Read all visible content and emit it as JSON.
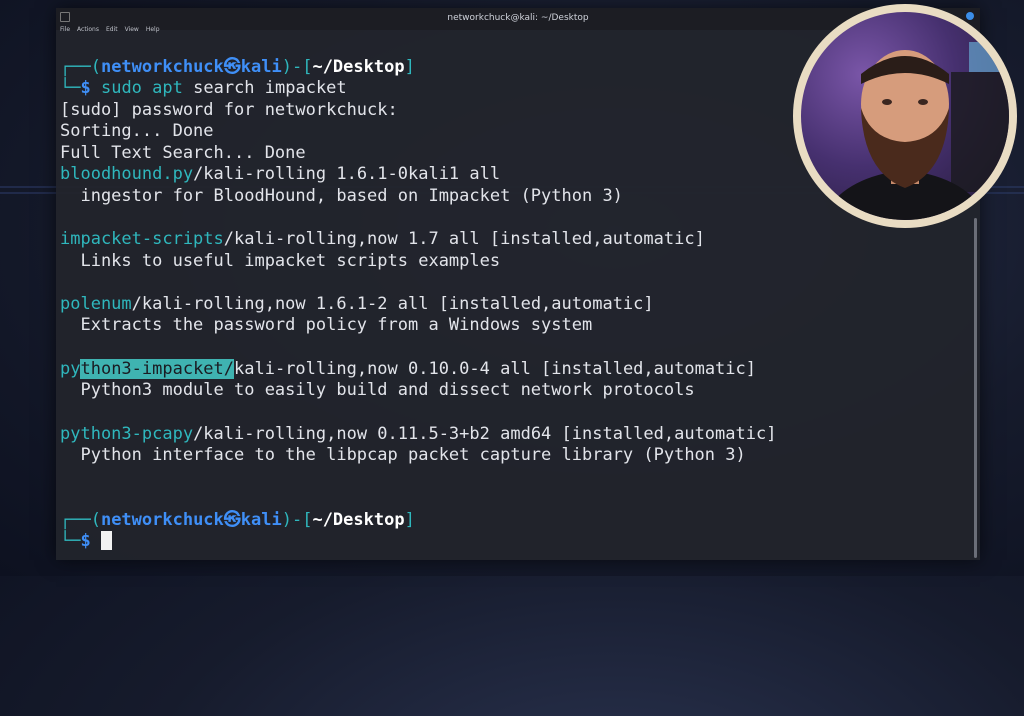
{
  "window": {
    "title": "networkchuck@kali: ~/Desktop",
    "menu": [
      "File",
      "Actions",
      "Edit",
      "View",
      "Help"
    ]
  },
  "prompt1": {
    "open": "┌──(",
    "user": "networkchuck",
    "at": "㉿",
    "host": "kali",
    "mid": ")-[",
    "path": "~/Desktop",
    "close": "]"
  },
  "command": {
    "corner": "└─",
    "dollar": "$ ",
    "sudo": "sudo",
    "apt": "apt",
    "rest": " search impacket"
  },
  "output": [
    "[sudo] password for networkchuck:",
    "Sorting... Done",
    "Full Text Search... Done"
  ],
  "packages": [
    {
      "name": "bloodhound.py",
      "info": "/kali-rolling 1.6.1-0kali1 all",
      "desc": "  ingestor for BloodHound, based on Impacket (Python 3)"
    },
    {
      "name": "impacket-scripts",
      "info": "/kali-rolling,now 1.7 all [installed,automatic]",
      "desc": "  Links to useful impacket scripts examples"
    },
    {
      "name": "polenum",
      "info": "/kali-rolling,now 1.6.1-2 all [installed,automatic]",
      "desc": "  Extracts the password policy from a Windows system"
    },
    {
      "name_pre": "py",
      "name_hl": "thon3-impacket/",
      "info": "kali-rolling,now 0.10.0-4 all [installed,automatic]",
      "desc": "  Python3 module to easily build and dissect network protocols"
    },
    {
      "name": "python3-pcapy",
      "info": "/kali-rolling,now 0.11.5-3+b2 amd64 [installed,automatic]",
      "desc": "  Python interface to the libpcap packet capture library (Python 3)"
    }
  ],
  "prompt2": {
    "open": "┌──(",
    "user": "networkchuck",
    "at": "㉿",
    "host": "kali",
    "mid": ")-[",
    "path": "~/Desktop",
    "close": "]",
    "corner": "└─",
    "dollar": "$ "
  },
  "colors": {
    "prompt_blue": "#3f8ff7",
    "teal": "#2fb7bd",
    "highlight": "#3fb3b1",
    "background": "#22242c"
  }
}
